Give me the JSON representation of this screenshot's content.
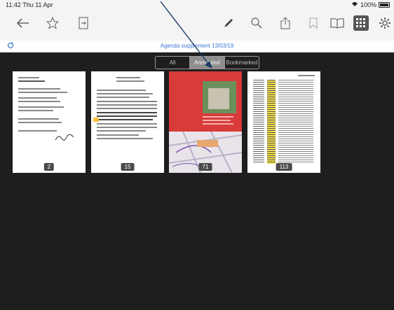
{
  "status": {
    "time": "11:42",
    "day": "Thu 11 Apr",
    "battery": "100%"
  },
  "toolbar": {
    "icons": [
      "back-arrow-icon",
      "star-icon",
      "export-page-icon",
      "pen-icon",
      "search-icon",
      "share-icon",
      "bookmark-icon",
      "book-icon",
      "grid-icon",
      "gear-icon"
    ]
  },
  "breadcrumb": {
    "left_icon": "sync-icon",
    "title": "Agenda supplement 13/03/19"
  },
  "segments": [
    {
      "label": "All",
      "active": false
    },
    {
      "label": "Annotated",
      "active": true
    },
    {
      "label": "Bookmarked",
      "active": false
    }
  ],
  "pages": [
    {
      "number": "2"
    },
    {
      "number": "15"
    },
    {
      "number": "71"
    },
    {
      "number": "113"
    }
  ],
  "colors": {
    "accent": "#3b78d8",
    "dark_bg": "#1e1e1e",
    "highlight_red": "#d93a3a",
    "highlight_yellow": "#f3e046"
  }
}
